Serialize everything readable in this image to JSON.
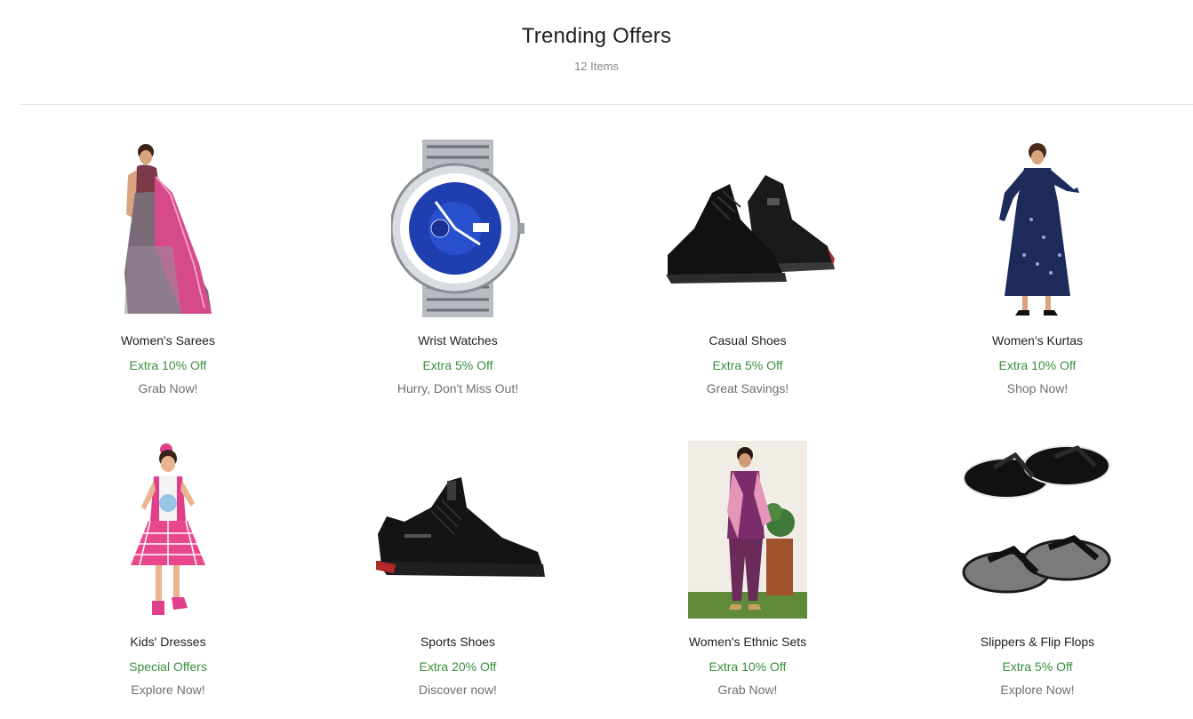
{
  "header": {
    "title": "Trending Offers",
    "count": "12 Items"
  },
  "colors": {
    "offer_green": "#388e3c",
    "muted_text": "#878787",
    "divider": "#e6e6e6"
  },
  "products": [
    {
      "name": "Women's Sarees",
      "offer": "Extra 10% Off",
      "tagline": "Grab Now!",
      "image": "saree-image"
    },
    {
      "name": "Wrist Watches",
      "offer": "Extra 5% Off",
      "tagline": "Hurry, Don't Miss Out!",
      "image": "watch-image"
    },
    {
      "name": "Casual Shoes",
      "offer": "Extra 5% Off",
      "tagline": "Great Savings!",
      "image": "casual-shoe-image"
    },
    {
      "name": "Women's Kurtas",
      "offer": "Extra 10% Off",
      "tagline": "Shop Now!",
      "image": "kurta-image"
    },
    {
      "name": "Kids' Dresses",
      "offer": "Special Offers",
      "tagline": "Explore Now!",
      "image": "kids-dress-image"
    },
    {
      "name": "Sports Shoes",
      "offer": "Extra 20% Off",
      "tagline": "Discover now!",
      "image": "sports-shoe-image"
    },
    {
      "name": "Women's Ethnic Sets",
      "offer": "Extra 10% Off",
      "tagline": "Grab Now!",
      "image": "ethnic-set-image"
    },
    {
      "name": "Slippers & Flip Flops",
      "offer": "Extra 5% Off",
      "tagline": "Explore Now!",
      "image": "flip-flop-image"
    }
  ]
}
